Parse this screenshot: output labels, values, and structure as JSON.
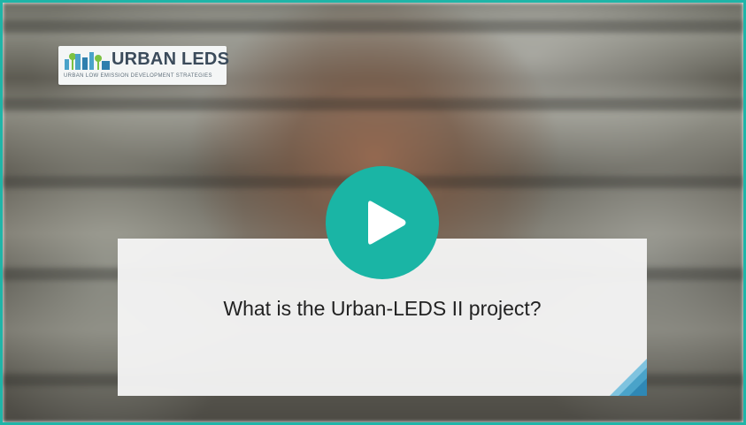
{
  "logo": {
    "title": "URBAN LEDS",
    "subtitle": "URBAN LOW EMISSION DEVELOPMENT STRATEGIES"
  },
  "video": {
    "caption": "What is the Urban-LEDS II project?",
    "play_icon": "play-icon"
  },
  "colors": {
    "accent": "#1ab5a5",
    "border": "#1fb5a8",
    "logo_text": "#3b4b5b",
    "card_corner": "#4aa3c9"
  }
}
